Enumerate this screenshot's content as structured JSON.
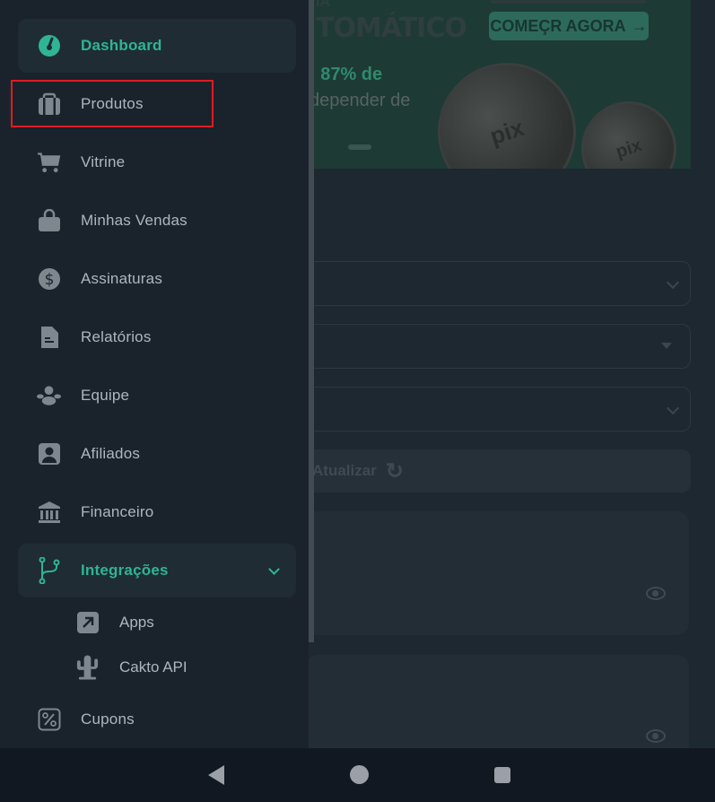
{
  "banner": {
    "line1": "IA",
    "line2": "TOMÁTICO",
    "percent_text": ": 87% de",
    "sub_text": "depender de",
    "cta_label": "COMEÇR AGORA",
    "cta_arrow": "→",
    "coin_text": "pix"
  },
  "refresh_button": {
    "label": "Atualizar",
    "icon": "refresh-icon"
  },
  "sidebar": {
    "items": [
      {
        "label": "Dashboard",
        "icon": "gauge-icon",
        "active": true
      },
      {
        "label": "Produtos",
        "icon": "briefcase-icon",
        "highlighted": true
      },
      {
        "label": "Vitrine",
        "icon": "cart-icon"
      },
      {
        "label": "Minhas Vendas",
        "icon": "shopping-bag-icon"
      },
      {
        "label": "Assinaturas",
        "icon": "dollar-icon"
      },
      {
        "label": "Relatórios",
        "icon": "document-icon"
      },
      {
        "label": "Equipe",
        "icon": "team-icon"
      },
      {
        "label": "Afiliados",
        "icon": "person-badge-icon"
      },
      {
        "label": "Financeiro",
        "icon": "bank-icon"
      },
      {
        "label": "Integrações",
        "icon": "branch-icon",
        "active": true,
        "expanded": true
      },
      {
        "label": "Cupons",
        "icon": "percent-icon"
      }
    ],
    "subitems": [
      {
        "label": "Apps",
        "icon": "arrow-up-right-icon"
      },
      {
        "label": "Cakto API",
        "icon": "cactus-icon"
      }
    ]
  },
  "colors": {
    "accent": "#2fb495",
    "drawer_bg": "#1a232c",
    "highlight": "#e01b22"
  },
  "system_nav": {
    "back": "back-icon",
    "home": "home-icon",
    "recent": "recent-apps-icon"
  }
}
